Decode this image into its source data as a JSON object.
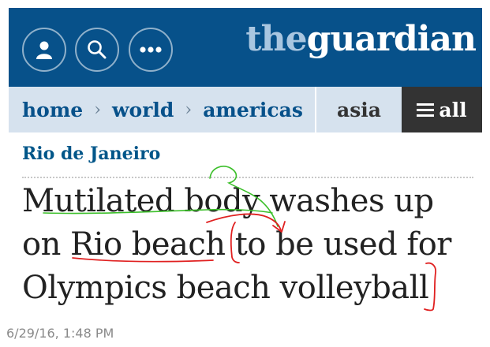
{
  "header": {
    "logo_prefix": "the",
    "logo_suffix": "guardian",
    "buttons": [
      {
        "icon": "profile-icon"
      },
      {
        "icon": "search-icon"
      },
      {
        "icon": "more-icon"
      }
    ],
    "brand_color": "#07518a"
  },
  "nav": {
    "crumbs": [
      "home",
      "world",
      "americas"
    ],
    "separator": "›",
    "asia_label": "asia",
    "all_label": "all",
    "background_color": "#d6e2ee"
  },
  "article": {
    "section": "Rio de Janeiro",
    "headline": "Mutilated body washes up on Rio beach to be used for Olympics beach volleyball"
  },
  "annotations": {
    "red_color": "#e02020",
    "green_color": "#3cbf2a"
  },
  "timestamp": "6/29/16, 1:48 PM"
}
